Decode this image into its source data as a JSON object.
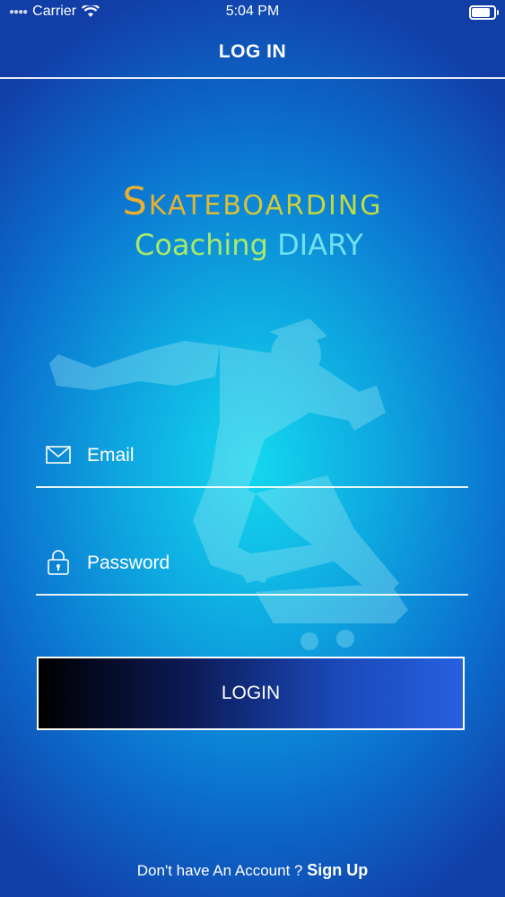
{
  "status_bar": {
    "carrier": "Carrier",
    "time": "5:04 PM"
  },
  "nav": {
    "title": "LOG IN"
  },
  "logo": {
    "main": "Skateboarding",
    "sub_word1": "Coaching",
    "sub_word2": "DIARY"
  },
  "form": {
    "email_placeholder": "Email",
    "password_placeholder": "Password",
    "login_label": "LOGIN"
  },
  "footer": {
    "prompt": "Don't have An Account ? ",
    "signup_label": "Sign Up"
  },
  "icons": [
    "wifi-icon",
    "battery-icon",
    "mail-icon",
    "lock-icon",
    "skater-illustration"
  ],
  "colors": {
    "accent_orange": "#f7a125",
    "accent_green": "#a8e86a",
    "accent_cyan": "#6fe0ee"
  }
}
